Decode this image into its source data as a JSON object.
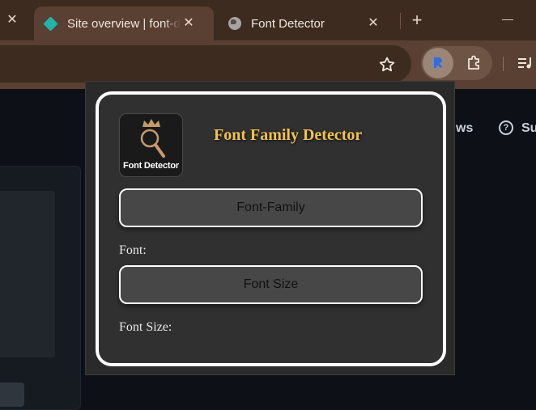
{
  "browser": {
    "tabs": [
      {
        "title": "Site overview | font-d",
        "active": true,
        "favicon": "diamond-icon"
      },
      {
        "title": "Font Detector",
        "active": false,
        "favicon": "globe-icon"
      }
    ],
    "close_glyph": "✕",
    "new_tab_glyph": "+"
  },
  "page": {
    "nav_fragment_1": "ws",
    "nav_fragment_2": "Su",
    "help_glyph": "?"
  },
  "popup": {
    "logo_text": "Font Detector",
    "title": "Font Family Detector",
    "font_family_button": "Font-Family",
    "font_label": "Font:",
    "font_size_button": "Font Size",
    "font_size_label": "Font Size:"
  },
  "colors": {
    "tabbar": "#3d2b20",
    "toolbar": "#5a4032",
    "popup_title": "#f2c24e",
    "frame_border": "#ffffff"
  }
}
